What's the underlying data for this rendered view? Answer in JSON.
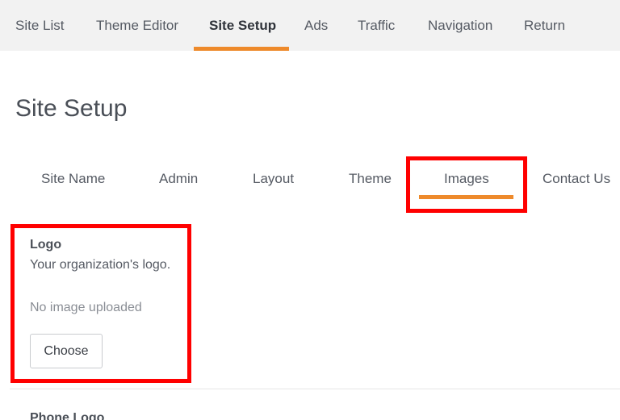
{
  "topnav": {
    "tabs": [
      {
        "label": "Site List"
      },
      {
        "label": "Theme Editor"
      },
      {
        "label": "Site Setup",
        "active": true
      },
      {
        "label": "Ads"
      },
      {
        "label": "Traffic"
      },
      {
        "label": "Navigation"
      },
      {
        "label": "Return"
      }
    ]
  },
  "page": {
    "title": "Site Setup"
  },
  "subnav": {
    "tabs": [
      {
        "label": "Site Name"
      },
      {
        "label": "Admin"
      },
      {
        "label": "Layout"
      },
      {
        "label": "Theme"
      },
      {
        "label": "Images",
        "active": true
      },
      {
        "label": "Contact Us"
      }
    ]
  },
  "logo_section": {
    "title": "Logo",
    "description": "Your organization's logo.",
    "status": "No image uploaded",
    "button_label": "Choose"
  },
  "phone_logo_section": {
    "title": "Phone Logo"
  },
  "colors": {
    "accent": "#ee8a2b",
    "highlight": "#ff0000",
    "nav_background": "#f2f2f2"
  }
}
